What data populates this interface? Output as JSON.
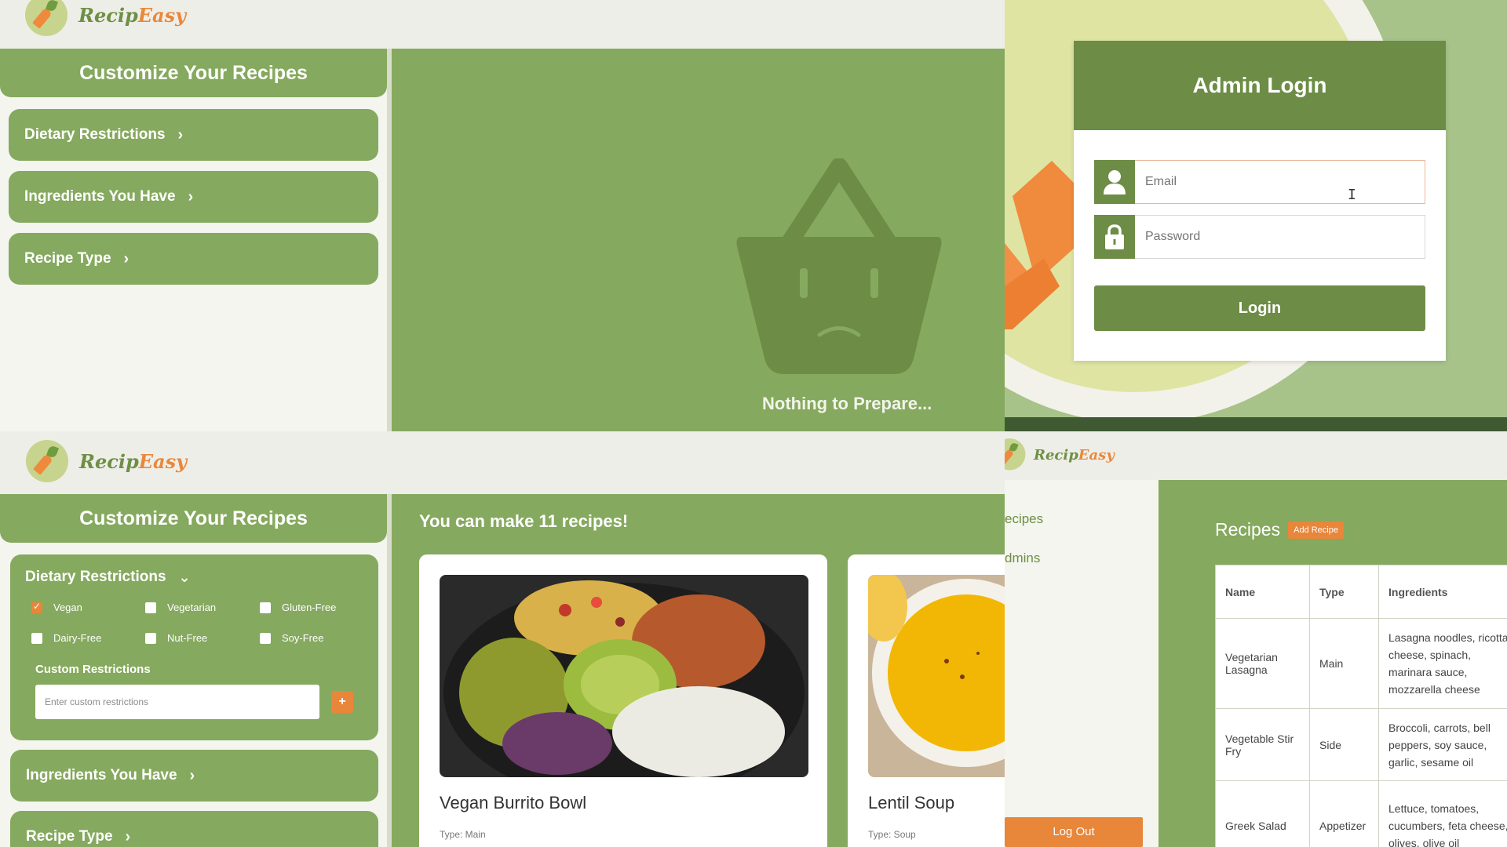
{
  "brand": {
    "name_part1": "Recip",
    "name_part2": "Easy"
  },
  "customize": {
    "title": "Customize Your Recipes",
    "sections": [
      {
        "label": "Dietary Restrictions"
      },
      {
        "label": "Ingredients You Have"
      },
      {
        "label": "Recipe Type"
      }
    ],
    "chevron_right": "›",
    "chevron_down": "⌄"
  },
  "empty_state": {
    "message": "Nothing to Prepare..."
  },
  "login": {
    "title": "Admin Login",
    "email_placeholder": "Email",
    "password_placeholder": "Password",
    "button": "Login"
  },
  "dietary": {
    "options": [
      {
        "label": "Vegan",
        "checked": true
      },
      {
        "label": "Vegetarian",
        "checked": false
      },
      {
        "label": "Gluten-Free",
        "checked": false
      },
      {
        "label": "Dairy-Free",
        "checked": false
      },
      {
        "label": "Nut-Free",
        "checked": false
      },
      {
        "label": "Soy-Free",
        "checked": false
      }
    ],
    "custom_label": "Custom Restrictions",
    "custom_placeholder": "Enter custom restrictions",
    "add_label": "+"
  },
  "results": {
    "title": "You can make 11 recipes!",
    "cards": [
      {
        "title": "Vegan Burrito Bowl",
        "type": "Type: Main"
      },
      {
        "title": "Lentil Soup",
        "type": "Type: Soup"
      }
    ]
  },
  "admin": {
    "nav": [
      "ecipes",
      "dmins"
    ],
    "logout": "Log Out",
    "recipes_title": "Recipes",
    "add_recipe": "Add Recipe",
    "table": {
      "headers": [
        "Name",
        "Type",
        "Ingredients"
      ],
      "rows": [
        {
          "name": "Vegetarian Lasagna",
          "type": "Main",
          "ingredients": "Lasagna noodles, ricotta cheese, spinach, marinara sauce, mozzarella cheese"
        },
        {
          "name": "Vegetable Stir Fry",
          "type": "Side",
          "ingredients": "Broccoli, carrots, bell peppers, soy sauce, garlic, sesame oil"
        },
        {
          "name": "Greek Salad",
          "type": "Appetizer",
          "ingredients": "Lettuce, tomatoes, cucumbers, feta cheese, olives, olive oil"
        }
      ]
    }
  },
  "colors": {
    "primary_green": "#85a95e",
    "dark_green": "#6d8c45",
    "accent_orange": "#e8863a",
    "background": "#eeeee8"
  }
}
